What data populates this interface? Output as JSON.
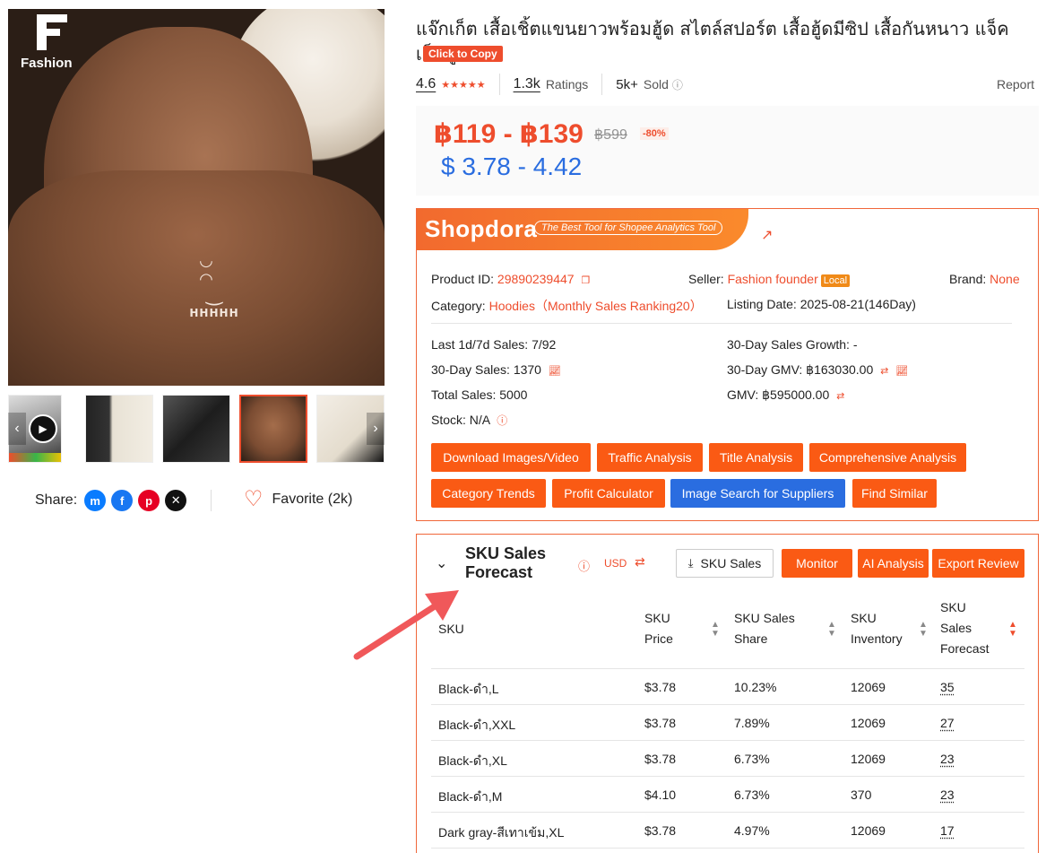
{
  "gallery": {
    "brand_text": "Fashion",
    "thumbnails": [
      "video",
      "cream-black",
      "dark",
      "brown",
      "cream"
    ],
    "active_thumb": 3
  },
  "share": {
    "label": "Share:",
    "favorite_label": "Favorite (2k)"
  },
  "product": {
    "title": "แจ๊กเก็ต เสื้อเชิ้ตแขนยาวพร้อมฮู้ด สไตล์สปอร์ต เสื้อฮู้ดมีซิป เสื้อกันหนาว แจ็คเก็ตคู่",
    "copy_label": "Click to Copy",
    "rating": "4.6",
    "ratings_count": "1.3k",
    "ratings_label": "Ratings",
    "sold_count": "5k+",
    "sold_label": "Sold",
    "report_label": "Report",
    "price_range": "฿119 - ฿139",
    "original_price": "฿599",
    "discount": "-80%",
    "price_usd": "$ 3.78 - 4.42"
  },
  "shopdora": {
    "logo": "Shopdora",
    "tagline": "The Best Tool for Shopee Analytics Tool",
    "product_id_label": "Product ID:",
    "product_id": "29890239447",
    "seller_label": "Seller:",
    "seller": "Fashion founder",
    "seller_badge": "Local",
    "brand_label": "Brand:",
    "brand": "None",
    "category_label": "Category:",
    "category": "Hoodies（Monthly Sales Ranking20）",
    "listing_date_label": "Listing Date:",
    "listing_date": "2025-08-21(146Day)",
    "last_sales": "Last 1d/7d Sales: 7/92",
    "growth": "30-Day Sales Growth: -",
    "sales30": "30-Day Sales: 1370",
    "gmv30": "30-Day GMV: ฿163030.00",
    "total_sales": "Total Sales: 5000",
    "gmv": "GMV: ฿595000.00",
    "stock": "Stock: N/A",
    "buttons": [
      "Download Images/Video",
      "Traffic Analysis",
      "Title Analysis",
      "Comprehensive Analysis",
      "Category Trends",
      "Profit Calculator",
      "Image Search for Suppliers",
      "Find Similar"
    ]
  },
  "sku": {
    "title_line1": "SKU Sales",
    "title_line2": "Forecast",
    "currency": "USD",
    "sku_sales_btn": "SKU Sales",
    "monitor_btn": "Monitor",
    "ai_btn": "AI Analysis",
    "export_btn": "Export Review",
    "headers": {
      "sku": "SKU",
      "price": [
        "SKU",
        "Price"
      ],
      "share": [
        "SKU Sales",
        "Share"
      ],
      "inventory": [
        "SKU",
        "Inventory"
      ],
      "forecast": [
        "SKU",
        "Sales",
        "Forecast"
      ]
    },
    "rows": [
      {
        "sku": "Black-ดำ,L",
        "price": "$3.78",
        "share": "10.23%",
        "inventory": "12069",
        "forecast": "35"
      },
      {
        "sku": "Black-ดำ,XXL",
        "price": "$3.78",
        "share": "7.89%",
        "inventory": "12069",
        "forecast": "27"
      },
      {
        "sku": "Black-ดำ,XL",
        "price": "$3.78",
        "share": "6.73%",
        "inventory": "12069",
        "forecast": "23"
      },
      {
        "sku": "Black-ดำ,M",
        "price": "$4.10",
        "share": "6.73%",
        "inventory": "370",
        "forecast": "23"
      },
      {
        "sku": "Dark gray-สีเทาเข้ม,XL",
        "price": "$3.78",
        "share": "4.97%",
        "inventory": "12069",
        "forecast": "17"
      }
    ]
  },
  "colors": {
    "accent": "#ee4d2d",
    "shopdora_orange": "#fa5a14",
    "blue": "#2a6de0"
  }
}
